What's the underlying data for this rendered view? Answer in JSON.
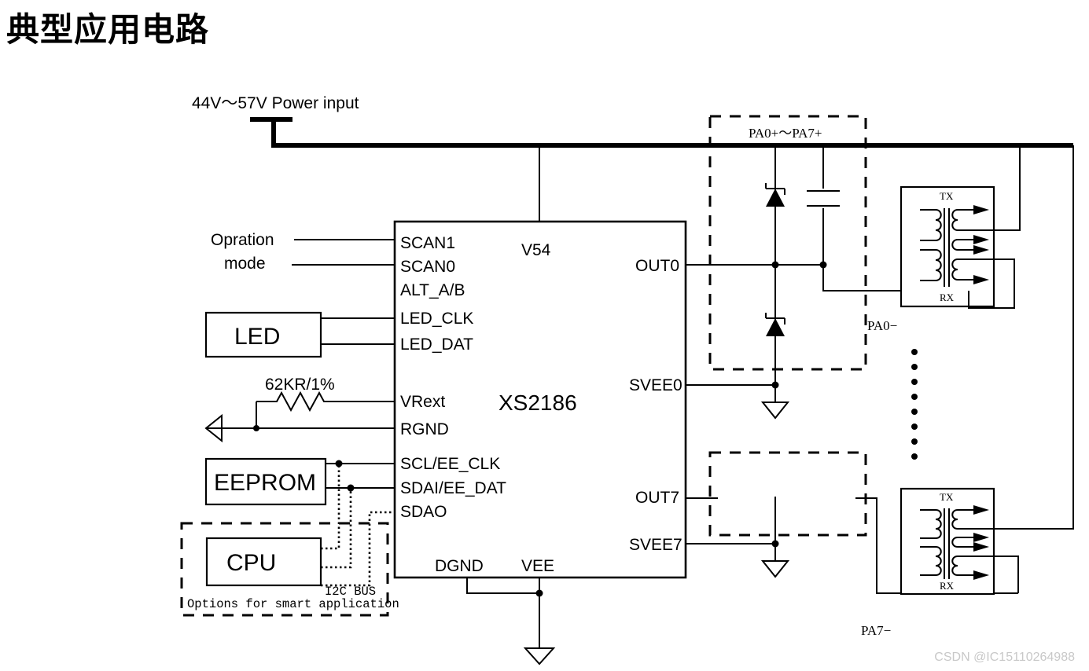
{
  "page": {
    "title": "典型应用电路",
    "watermark": "CSDN @IC15110264988"
  },
  "power": {
    "input_label": "44V～57V Power input"
  },
  "chip": {
    "part_number": "XS2186",
    "pins_left": [
      {
        "name": "SCAN1"
      },
      {
        "name": "SCAN0"
      },
      {
        "name": "ALT_A/B"
      },
      {
        "name": "LED_CLK"
      },
      {
        "name": "LED_DAT"
      },
      {
        "name": "VRext"
      },
      {
        "name": "RGND"
      },
      {
        "name": "SCL/EE_CLK"
      },
      {
        "name": "SDAI/EE_DAT"
      },
      {
        "name": "SDAO"
      }
    ],
    "pins_top": [
      {
        "name": "V54"
      }
    ],
    "pins_right": [
      {
        "name": "OUT0"
      },
      {
        "name": "SVEE0"
      },
      {
        "name": "OUT7"
      },
      {
        "name": "SVEE7"
      }
    ],
    "pins_bottom": [
      {
        "name": "DGND"
      },
      {
        "name": "VEE"
      }
    ]
  },
  "left_side": {
    "operation_mode_line1": "Opration",
    "operation_mode_line2": "mode",
    "led_block": "LED",
    "resistor_value": "62KR/1%",
    "eeprom_block": "EEPROM",
    "cpu_block": "CPU",
    "i2c_bus_label": "I2C BUS",
    "options_note": "Options for smart application"
  },
  "right_side": {
    "port_plus_label": "PA0+～PA7+",
    "port0_minus_label": "PA0−",
    "port7_minus_label": "PA7−",
    "magnetics_top": {
      "tx": "TX",
      "rx": "RX"
    },
    "magnetics_bottom": {
      "tx": "TX",
      "rx": "RX"
    },
    "ellipsis_dot_count": 8
  },
  "colors": {
    "line": "#000000",
    "background": "#ffffff",
    "watermark": "#c8c8c8"
  }
}
